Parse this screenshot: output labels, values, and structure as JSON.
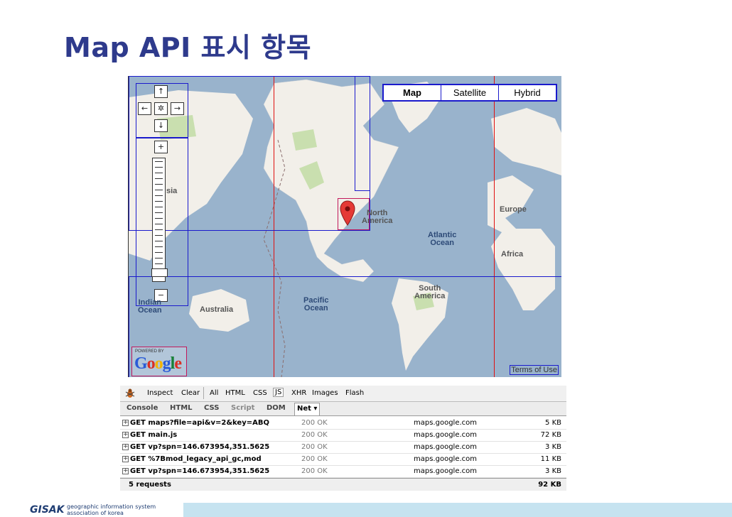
{
  "slide": {
    "title": "Map API 표시 항목"
  },
  "map": {
    "map_types": [
      "Map",
      "Satellite",
      "Hybrid"
    ],
    "active_map_type": "Map",
    "nav_icons": {
      "up": "↑",
      "left": "←",
      "center": "✲",
      "right": "→",
      "down": "↓",
      "zoom_in": "+",
      "zoom_out": "−"
    },
    "labels": {
      "north_america": "North\nAmerica",
      "atlantic": "Atlantic\nOcean",
      "europe": "Europe",
      "africa": "Africa",
      "south_america": "South\nAmerica",
      "pacific": "Pacific\nOcean",
      "australia": "Australia",
      "indian": "Indian\nOcean",
      "asia": "sia"
    },
    "powered_by": "POWERED BY",
    "google_letters": [
      "G",
      "o",
      "o",
      "g",
      "l",
      "e"
    ],
    "google_colors": [
      "#2a5bd7",
      "#d93025",
      "#f4b400",
      "#2a5bd7",
      "#188038",
      "#d93025"
    ],
    "terms": "Terms of Use",
    "colors": {
      "water": "#99b3cc",
      "land": "#f2efe9",
      "forest": "#c9dfaf",
      "marker": "#e53935"
    }
  },
  "firebug": {
    "toolbar": {
      "inspect": "Inspect",
      "clear": "Clear",
      "filters": [
        "All",
        "HTML",
        "CSS",
        "JS",
        "XHR",
        "Images",
        "Flash"
      ],
      "active_filter": "JS"
    },
    "tabs": [
      "Console",
      "HTML",
      "CSS",
      "Script",
      "DOM",
      "Net ▾"
    ],
    "active_tab": "Net ▾",
    "requests": [
      {
        "url": "GET maps?file=api&v=2&key=ABQ",
        "status": "200 OK",
        "domain": "maps.google.com",
        "size": "5 KB"
      },
      {
        "url": "GET main.js",
        "status": "200 OK",
        "domain": "maps.google.com",
        "size": "72 KB"
      },
      {
        "url": "GET vp?spn=146.673954,351.5625",
        "status": "200 OK",
        "domain": "maps.google.com",
        "size": "3 KB"
      },
      {
        "url": "GET %7Bmod_legacy_api_gc,mod",
        "status": "200 OK",
        "domain": "maps.google.com",
        "size": "11 KB"
      },
      {
        "url": "GET vp?spn=146.673954,351.5625",
        "status": "200 OK",
        "domain": "maps.google.com",
        "size": "3 KB"
      }
    ],
    "summary": {
      "count": "5 requests",
      "total": "92 KB"
    }
  },
  "footer": {
    "logo": "GISAK",
    "line1": "geographic information system",
    "line2": "association of korea"
  }
}
